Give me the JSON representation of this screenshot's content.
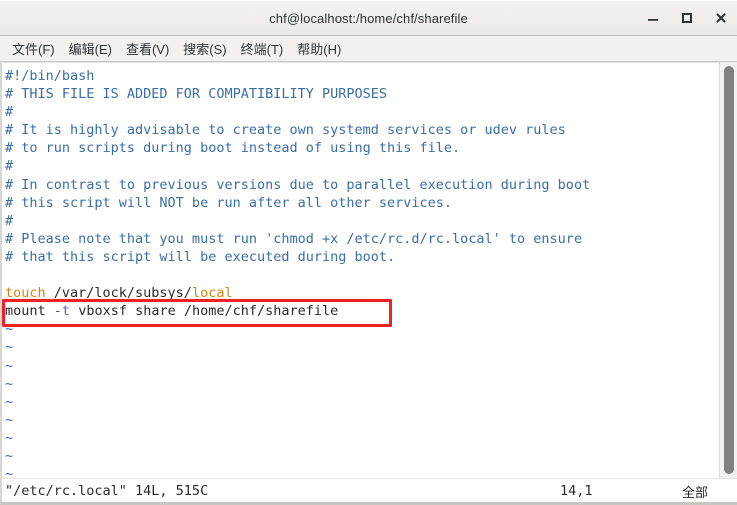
{
  "window": {
    "title": "chf@localhost:/home/chf/sharefile",
    "controls": [
      {
        "name": "minimize",
        "glyph": "–"
      },
      {
        "name": "maximize",
        "glyph": "□"
      },
      {
        "name": "close",
        "glyph": "✕"
      }
    ]
  },
  "menubar": {
    "items": [
      {
        "label": "文件(F)"
      },
      {
        "label": "编辑(E)"
      },
      {
        "label": "查看(V)"
      },
      {
        "label": "搜索(S)"
      },
      {
        "label": "终端(T)"
      },
      {
        "label": "帮助(H)"
      }
    ]
  },
  "editor": {
    "lines": [
      {
        "n": 1,
        "type": "comment",
        "text": "#!/bin/bash"
      },
      {
        "n": 2,
        "type": "comment",
        "text": "# THIS FILE IS ADDED FOR COMPATIBILITY PURPOSES"
      },
      {
        "n": 3,
        "type": "comment",
        "text": "#"
      },
      {
        "n": 4,
        "type": "comment",
        "text": "# It is highly advisable to create own systemd services or udev rules"
      },
      {
        "n": 5,
        "type": "comment",
        "text": "# to run scripts during boot instead of using this file."
      },
      {
        "n": 6,
        "type": "comment",
        "text": "#"
      },
      {
        "n": 7,
        "type": "comment",
        "text": "# In contrast to previous versions due to parallel execution during boot"
      },
      {
        "n": 8,
        "type": "comment",
        "text": "# this script will NOT be run after all other services."
      },
      {
        "n": 9,
        "type": "comment",
        "text": "#"
      },
      {
        "n": 10,
        "type": "comment",
        "text": "# Please note that you must run 'chmod +x /etc/rc.d/rc.local' to ensure"
      },
      {
        "n": 11,
        "type": "comment",
        "text": "# that this script will be executed during boot."
      },
      {
        "n": 12,
        "type": "blank",
        "text": ""
      },
      {
        "n": 13,
        "type": "command",
        "text": "touch /var/lock/subsys/local",
        "tokens": [
          {
            "t": "touch",
            "c": "kw"
          },
          {
            "t": " /var/lock/subsys/",
            "c": "plain"
          },
          {
            "t": "local",
            "c": "kw"
          }
        ]
      },
      {
        "n": 14,
        "type": "command",
        "text": "mount -t vboxsf share /home/chf/sharefile",
        "highlighted": true,
        "tokens": [
          {
            "t": "mount ",
            "c": "plain"
          },
          {
            "t": "-",
            "c": "dash"
          },
          {
            "t": "t",
            "c": "opt"
          },
          {
            "t": " vboxsf share /home/chf/sharefile",
            "c": "plain"
          }
        ]
      }
    ],
    "empty_marker": "~",
    "empty_marker_count": 9,
    "annotation_color": "#ec2227"
  },
  "statusline": {
    "file_info": "\"/etc/rc.local\" 14L, 515C",
    "cursor_position": "14,1",
    "scroll_scope": "全部"
  },
  "colors": {
    "comment": "#3b6ea5",
    "keyword": "#d58512",
    "option": "#8a50a8",
    "text": "#2b2b2b",
    "background": "#ffffff",
    "chrome": "#f2f1f0",
    "scrollbar": "#808080",
    "annotation": "#ec2227"
  }
}
